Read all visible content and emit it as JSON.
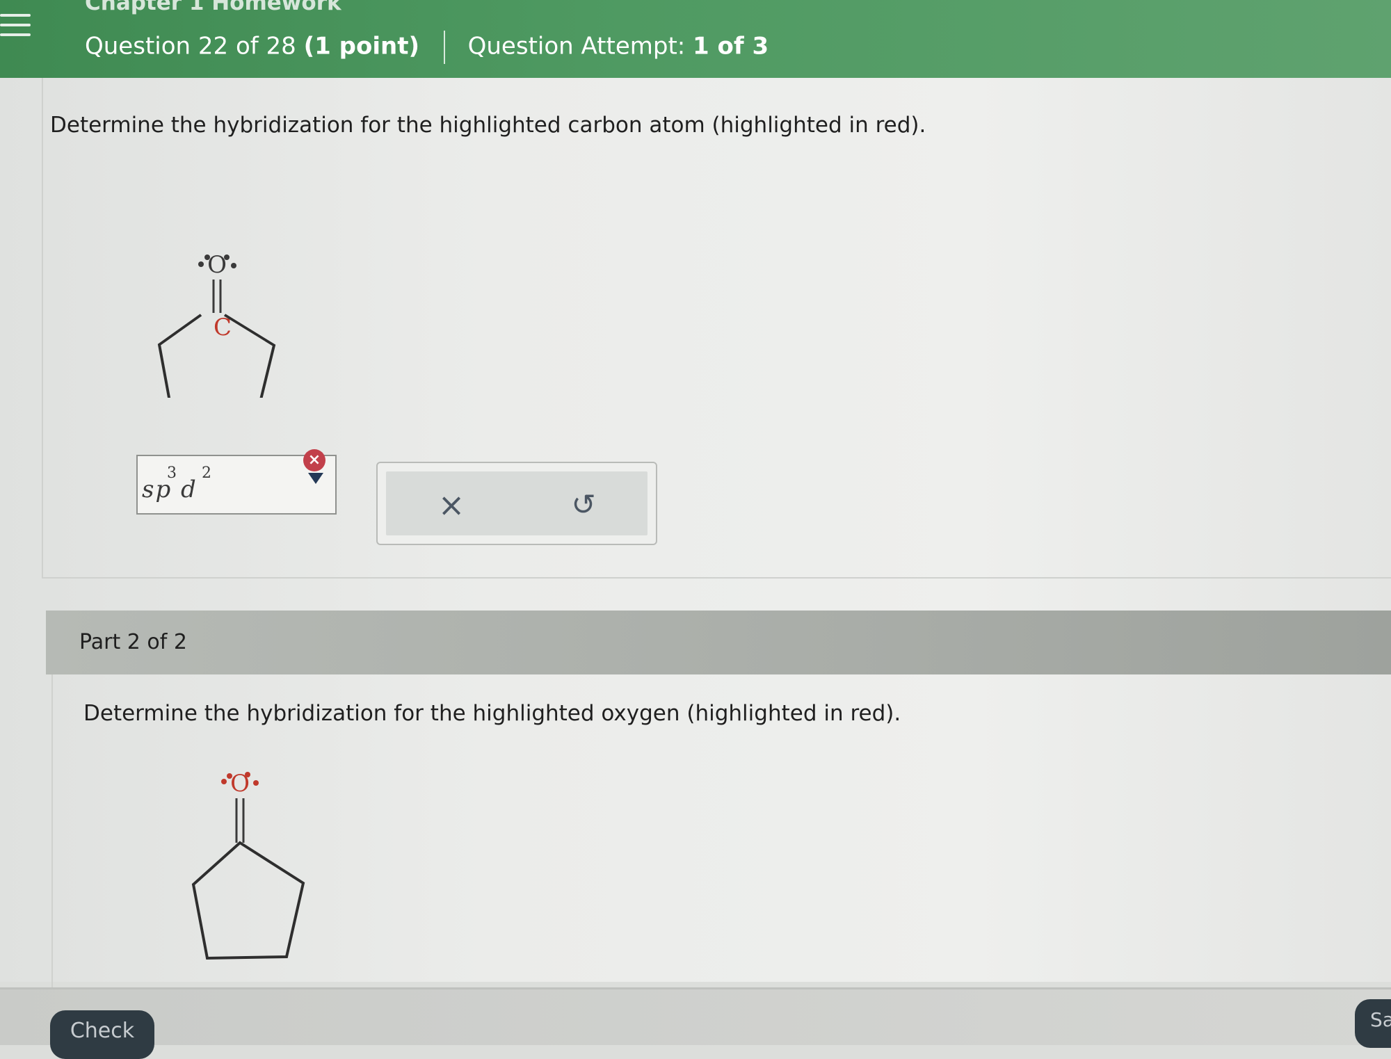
{
  "header": {
    "chapter_title": "Chapter 1 Homework",
    "question_label": "Question 22 of 28",
    "points_label": "(1 point)",
    "attempt_label": "Question Attempt:",
    "attempt_value": "1 of 3"
  },
  "part1": {
    "prompt": "Determine the hybridization for the highlighted carbon atom (highlighted in red).",
    "molecule": {
      "atom_oxygen": "O",
      "atom_carbon": "C",
      "highlighted_atom": "C",
      "highlight_color": "#c0392b"
    },
    "answer": {
      "base": "sp",
      "d_letter": "d",
      "sup_sp": "3",
      "sup_d": "2",
      "status": "incorrect"
    },
    "actions": {
      "clear": "×",
      "undo": "↺"
    }
  },
  "part2": {
    "label": "Part 2 of 2",
    "prompt": "Determine the hybridization for the highlighted oxygen (highlighted in red).",
    "molecule": {
      "atom_oxygen": "O",
      "highlighted_atom": "O",
      "highlight_color": "#c0392b"
    }
  },
  "footer": {
    "check_label": "Check",
    "save_label": "Sa"
  },
  "colors": {
    "header_green": "#4f9a62",
    "error_red": "#c2404b",
    "button_dark": "#2f3b43"
  }
}
